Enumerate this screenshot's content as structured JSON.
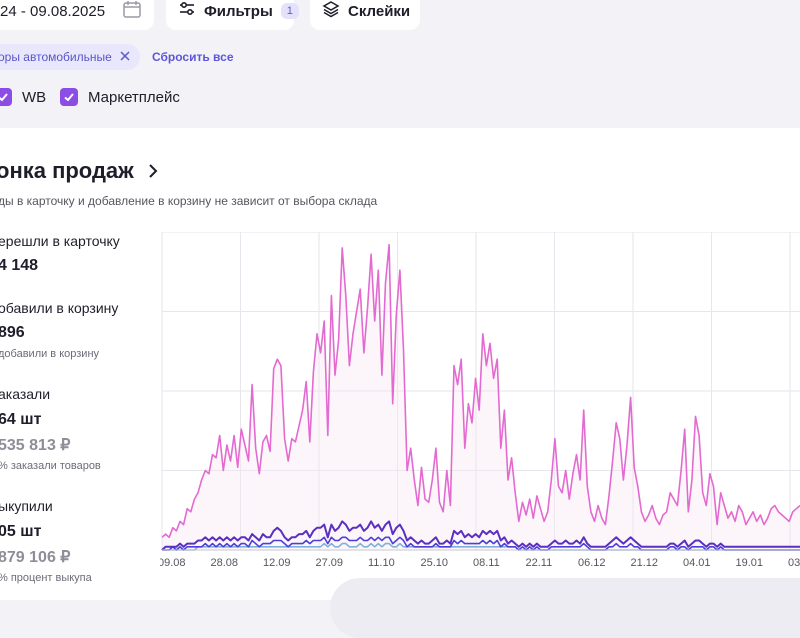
{
  "toolbar": {
    "date_range": "24 - 09.08.2025",
    "filters_label": "Фильтры",
    "filters_count": "1",
    "merge_label": "Склейки"
  },
  "filter_chip": {
    "label": "оры автомобильные"
  },
  "reset_label": "Сбросить все",
  "checkboxes": [
    {
      "label": "WB",
      "checked": true
    },
    {
      "label": "Маркетплейс",
      "checked": true
    }
  ],
  "section": {
    "title": "онка продаж",
    "subtitle": "ды в карточку и добавление в корзину не зависит от выбора склада"
  },
  "metrics": {
    "views_label": "ерешли в карточку",
    "views_value": "4 148",
    "cart_label": "обавили в корзину",
    "cart_value": "896",
    "cart_note": "добавили в корзину",
    "orders_label": "аказали",
    "orders_value": "64 шт",
    "orders_money": "535 813 ₽",
    "orders_note": "% заказали товаров",
    "buyouts_label": "ыкупили",
    "buyouts_value": "05 шт",
    "buyouts_money": "879 106 ₽",
    "buyouts_note": "% процент выкупа"
  },
  "colors": {
    "views": "#e36ad0",
    "cart": "#5b2fbf",
    "orders": "#4c3fd9",
    "buyouts": "#7fb0d8",
    "accent": "#5b57d9"
  },
  "chart_data": {
    "type": "line",
    "x_ticks": [
      "09.08",
      "28.08",
      "12.09",
      "27.09",
      "11.10",
      "25.10",
      "08.11",
      "22.11",
      "06.12",
      "21.12",
      "04.01",
      "19.01",
      "03.0"
    ],
    "ylim": [
      0,
      100
    ],
    "grid": true,
    "series": [
      {
        "key": "views",
        "values": [
          4,
          5,
          4,
          7,
          6,
          9,
          8,
          13,
          12,
          16,
          18,
          22,
          25,
          24,
          30,
          29,
          36,
          25,
          33,
          28,
          36,
          26,
          38,
          33,
          28,
          52,
          32,
          24,
          34,
          36,
          31,
          57,
          60,
          58,
          35,
          28,
          35,
          34,
          39,
          44,
          53,
          34,
          56,
          68,
          62,
          72,
          36,
          80,
          55,
          66,
          95,
          80,
          58,
          68,
          75,
          82,
          62,
          76,
          93,
          72,
          88,
          55,
          84,
          96,
          46,
          74,
          88,
          63,
          25,
          32,
          22,
          14,
          26,
          16,
          15,
          22,
          32,
          15,
          12,
          25,
          14,
          58,
          52,
          60,
          32,
          46,
          40,
          54,
          44,
          68,
          58,
          65,
          54,
          60,
          32,
          44,
          22,
          29,
          18,
          9,
          15,
          11,
          16,
          10,
          17,
          13,
          9,
          12,
          22,
          35,
          20,
          18,
          25,
          16,
          24,
          30,
          22,
          44,
          20,
          12,
          9,
          14,
          10,
          8,
          17,
          28,
          40,
          35,
          22,
          33,
          48,
          26,
          20,
          12,
          9,
          11,
          14,
          10,
          8,
          11,
          12,
          18,
          16,
          14,
          25,
          38,
          12,
          22,
          42,
          36,
          18,
          14,
          24,
          20,
          8,
          18,
          14,
          10,
          12,
          9,
          14,
          12,
          8,
          10,
          12,
          9,
          11,
          8,
          10,
          13,
          14,
          12,
          11,
          10,
          9,
          12,
          13,
          14
        ]
      },
      {
        "key": "cart",
        "values": [
          0,
          1,
          1,
          1,
          1,
          2,
          1,
          2,
          2,
          2,
          3,
          3,
          4,
          3,
          4,
          3,
          4,
          3,
          4,
          3,
          4,
          3,
          4,
          4,
          3,
          5,
          4,
          3,
          5,
          4,
          4,
          6,
          7,
          6,
          4,
          3,
          4,
          4,
          5,
          5,
          6,
          4,
          6,
          7,
          7,
          8,
          4,
          8,
          6,
          7,
          9,
          8,
          6,
          7,
          7,
          8,
          6,
          7,
          9,
          7,
          8,
          6,
          8,
          9,
          5,
          7,
          8,
          6,
          3,
          4,
          3,
          2,
          3,
          2,
          2,
          3,
          4,
          2,
          2,
          3,
          2,
          6,
          5,
          6,
          4,
          5,
          4,
          5,
          4,
          6,
          5,
          6,
          5,
          6,
          3,
          4,
          2,
          3,
          2,
          1,
          2,
          1,
          2,
          1,
          2,
          1,
          1,
          1,
          2,
          3,
          2,
          2,
          3,
          2,
          2,
          3,
          2,
          4,
          2,
          1,
          1,
          1,
          1,
          1,
          2,
          3,
          4,
          3,
          2,
          3,
          4,
          3,
          2,
          1,
          1,
          1,
          1,
          1,
          1,
          1,
          1,
          2,
          2,
          1,
          2,
          3,
          1,
          2,
          3,
          3,
          2,
          1,
          2,
          2,
          1,
          2,
          1,
          1,
          1,
          1,
          1,
          1,
          1,
          1,
          1,
          1,
          1,
          1,
          1,
          1,
          1,
          1,
          1,
          1,
          1,
          1,
          1,
          1
        ]
      },
      {
        "key": "orders",
        "values": [
          0,
          0,
          0,
          1,
          0,
          1,
          0,
          1,
          1,
          1,
          1,
          1,
          2,
          1,
          2,
          1,
          2,
          1,
          2,
          1,
          2,
          1,
          2,
          2,
          1,
          3,
          2,
          1,
          2,
          2,
          2,
          3,
          3,
          3,
          2,
          1,
          2,
          2,
          2,
          2,
          3,
          2,
          3,
          3,
          3,
          4,
          2,
          4,
          3,
          3,
          4,
          4,
          3,
          3,
          3,
          4,
          3,
          3,
          4,
          3,
          4,
          3,
          4,
          4,
          2,
          3,
          4,
          3,
          1,
          2,
          1,
          1,
          1,
          1,
          1,
          1,
          2,
          1,
          1,
          1,
          1,
          3,
          2,
          3,
          2,
          2,
          2,
          2,
          2,
          3,
          2,
          3,
          2,
          3,
          1,
          2,
          1,
          1,
          1,
          0,
          1,
          0,
          1,
          0,
          1,
          0,
          0,
          0,
          1,
          1,
          1,
          1,
          1,
          1,
          1,
          1,
          1,
          2,
          1,
          0,
          0,
          0,
          0,
          0,
          1,
          1,
          2,
          1,
          1,
          1,
          2,
          1,
          1,
          0,
          0,
          0,
          0,
          0,
          0,
          0,
          0,
          1,
          1,
          0,
          1,
          1,
          0,
          1,
          1,
          1,
          1,
          0,
          1,
          1,
          0,
          1,
          0,
          0,
          0,
          0,
          0,
          0,
          0,
          0,
          0,
          0,
          0,
          0,
          0,
          0,
          0,
          0,
          0,
          0,
          0,
          0,
          0,
          0
        ]
      },
      {
        "key": "buyouts",
        "values": [
          0,
          0,
          0,
          0,
          0,
          0,
          0,
          0,
          0,
          0,
          1,
          1,
          1,
          1,
          1,
          1,
          1,
          1,
          1,
          1,
          1,
          1,
          1,
          1,
          1,
          1,
          1,
          1,
          1,
          1,
          1,
          1,
          1,
          1,
          1,
          1,
          1,
          1,
          1,
          1,
          1,
          1,
          1,
          1,
          1,
          2,
          1,
          2,
          1,
          1,
          2,
          2,
          1,
          1,
          1,
          2,
          1,
          1,
          2,
          1,
          2,
          1,
          2,
          2,
          1,
          1,
          2,
          1,
          1,
          1,
          1,
          1,
          1,
          1,
          1,
          1,
          1,
          1,
          1,
          1,
          1,
          1,
          1,
          1,
          1,
          1,
          1,
          1,
          1,
          1,
          1,
          1,
          1,
          1,
          1,
          1,
          1,
          1,
          1,
          0,
          0,
          0,
          0,
          0,
          0,
          0,
          0,
          0,
          0,
          0,
          0,
          0,
          0,
          0,
          0,
          0,
          0,
          0,
          0,
          0,
          0,
          0,
          0,
          0,
          0,
          0,
          0,
          0,
          0,
          0,
          0,
          0,
          0,
          0,
          0,
          0,
          0,
          0,
          0,
          0,
          0,
          0,
          0,
          0,
          0,
          0,
          0,
          0,
          0,
          0,
          0,
          0,
          0,
          0,
          0,
          0,
          0,
          0,
          0,
          0,
          0,
          0,
          0,
          0,
          0,
          0,
          0,
          0,
          0,
          0,
          0,
          0,
          0,
          0,
          0,
          0,
          0,
          0
        ]
      }
    ]
  }
}
